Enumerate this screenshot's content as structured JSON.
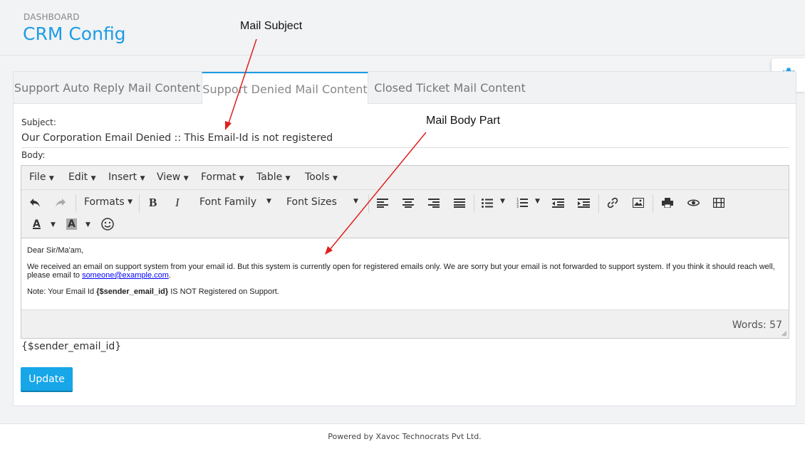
{
  "header": {
    "breadcrumb": "DASHBOARD",
    "title": "CRM Config"
  },
  "tabs": [
    {
      "label": "Support Auto Reply Mail Content",
      "active": false
    },
    {
      "label": "Support Denied Mail Content",
      "active": true
    },
    {
      "label": "Closed Ticket Mail Content",
      "active": false
    }
  ],
  "form": {
    "subject_label": "Subject:",
    "subject_value": "Our Corporation Email Denied :: This Email-Id is not registered",
    "body_label": "Body:",
    "variable_hint": "{$sender_email_id}",
    "update_label": "Update"
  },
  "editor": {
    "menus": [
      "File",
      "Edit",
      "Insert",
      "View",
      "Format",
      "Table",
      "Tools"
    ],
    "toolbar": {
      "formats": "Formats",
      "font_family": "Font Family",
      "font_sizes": "Font Sizes",
      "bold": "B",
      "italic": "I",
      "text_color": "A",
      "bg_color": "A"
    },
    "content": {
      "greeting": "Dear Sir/Ma'am,",
      "para1_text": "We received an email on support system from your email id. But this system is currently open for registered emails only. We are sorry but your email is not forwarded to support system. If you think it should reach well, please email to",
      "para1_link": "someone@example.com",
      "para1_end": ".",
      "note_prefix": "Note: Your Email Id",
      "note_var": "{$sender_email_id}",
      "note_suffix": "IS NOT Registered on Support."
    },
    "word_count": "Words: 57"
  },
  "annotations": {
    "mail_subject": "Mail Subject",
    "mail_body": "Mail Body Part"
  },
  "footer": {
    "text": "Powered by Xavoc Technocrats Pvt Ltd."
  },
  "colors": {
    "accent": "#1d9ce5",
    "button": "#17a6e8",
    "annotation_arrow": "#e02020"
  }
}
